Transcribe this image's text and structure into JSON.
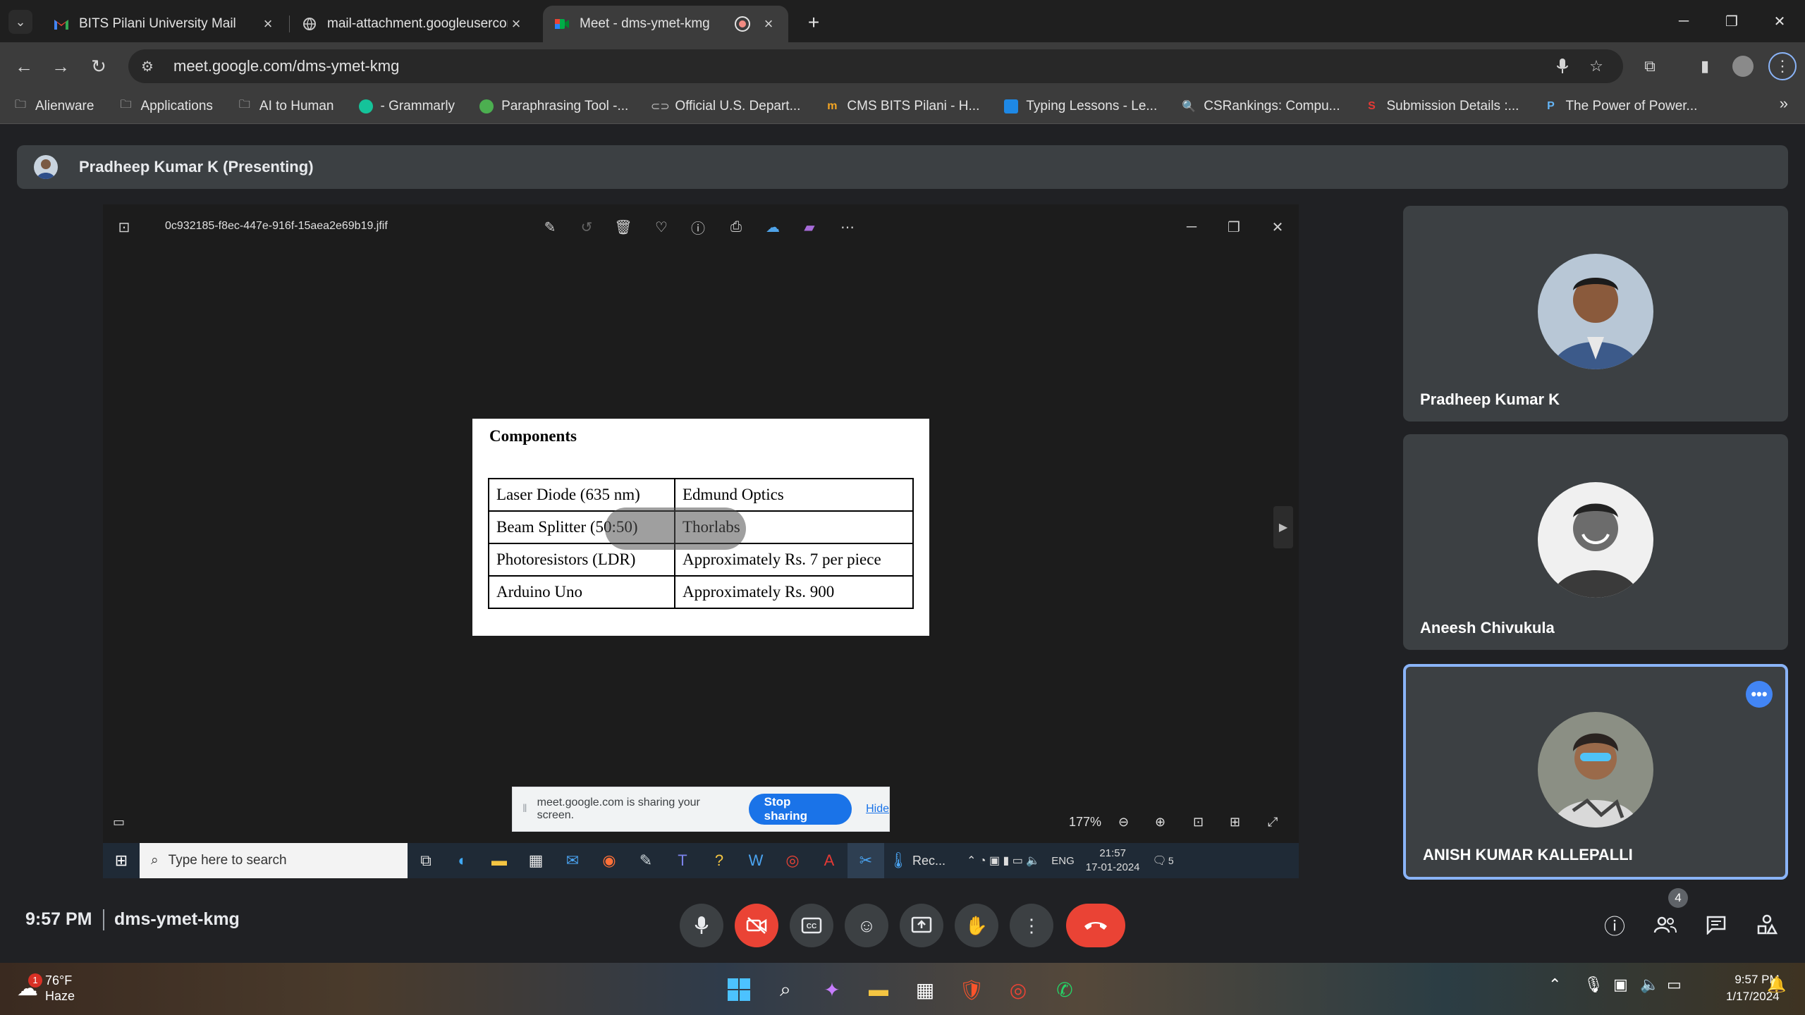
{
  "browser": {
    "tabs": [
      {
        "title": "BITS Pilani University Mail",
        "icon": "gmail-icon"
      },
      {
        "title": "mail-attachment.googleusercon",
        "icon": "globe-icon"
      },
      {
        "title": "Meet - dms-ymet-kmg",
        "icon": "meet-icon"
      }
    ],
    "url": "meet.google.com/dms-ymet-kmg",
    "bookmarks": [
      {
        "label": "Alienware",
        "icon": "folder-icon"
      },
      {
        "label": "Applications",
        "icon": "folder-icon"
      },
      {
        "label": "AI to Human",
        "icon": "folder-icon"
      },
      {
        "label": "- Grammarly",
        "icon": "grammarly-icon"
      },
      {
        "label": "Paraphrasing Tool -...",
        "icon": "quillbot-icon"
      },
      {
        "label": "Official U.S. Depart...",
        "icon": "link-icon"
      },
      {
        "label": "CMS BITS Pilani - H...",
        "icon": "cms-icon"
      },
      {
        "label": "Typing Lessons - Le...",
        "icon": "typing-icon"
      },
      {
        "label": "CSRankings: Compu...",
        "icon": "csrankings-icon"
      },
      {
        "label": "Submission Details :...",
        "icon": "submission-icon"
      },
      {
        "label": "The Power of Power...",
        "icon": "power-icon"
      }
    ]
  },
  "meet": {
    "presenter_label": "Pradheep Kumar K (Presenting)",
    "time": "9:57 PM",
    "code": "dms-ymet-kmg",
    "people_count": "4",
    "participants": [
      {
        "name": "Pradheep Kumar K"
      },
      {
        "name": "Aneesh Chivukula"
      },
      {
        "name": "ANISH KUMAR KALLEPALLI"
      }
    ]
  },
  "shared_screen": {
    "file_name": "0c932185-f8ec-447e-916f-15aea2e69b19.jfif",
    "doc_heading": "Components",
    "table": [
      [
        "Laser Diode (635 nm)",
        "Edmund Optics"
      ],
      [
        "Beam Splitter (50:50)",
        "Thorlabs"
      ],
      [
        "Photoresistors (LDR)",
        "Approximately Rs. 7 per piece"
      ],
      [
        "Arduino Uno",
        "Approximately Rs. 900"
      ]
    ],
    "zoom": "177%",
    "share_banner": {
      "message": "meet.google.com is sharing your screen.",
      "stop": "Stop sharing",
      "hide": "Hide"
    },
    "taskbar": {
      "search_placeholder": "Type here to search",
      "rec_label": "Rec...",
      "lang": "ENG",
      "time": "21:57",
      "date": "17-01-2024",
      "notif_count": "5"
    }
  },
  "windows": {
    "weather_temp": "76°F",
    "weather_desc": "Haze",
    "weather_badge": "1",
    "time": "9:57 PM",
    "date": "1/17/2024"
  },
  "colors": {
    "meet_bg": "#202124",
    "tile_bg": "#3c4043",
    "accent_blue": "#1a73e8",
    "end_call_red": "#ea4335"
  }
}
